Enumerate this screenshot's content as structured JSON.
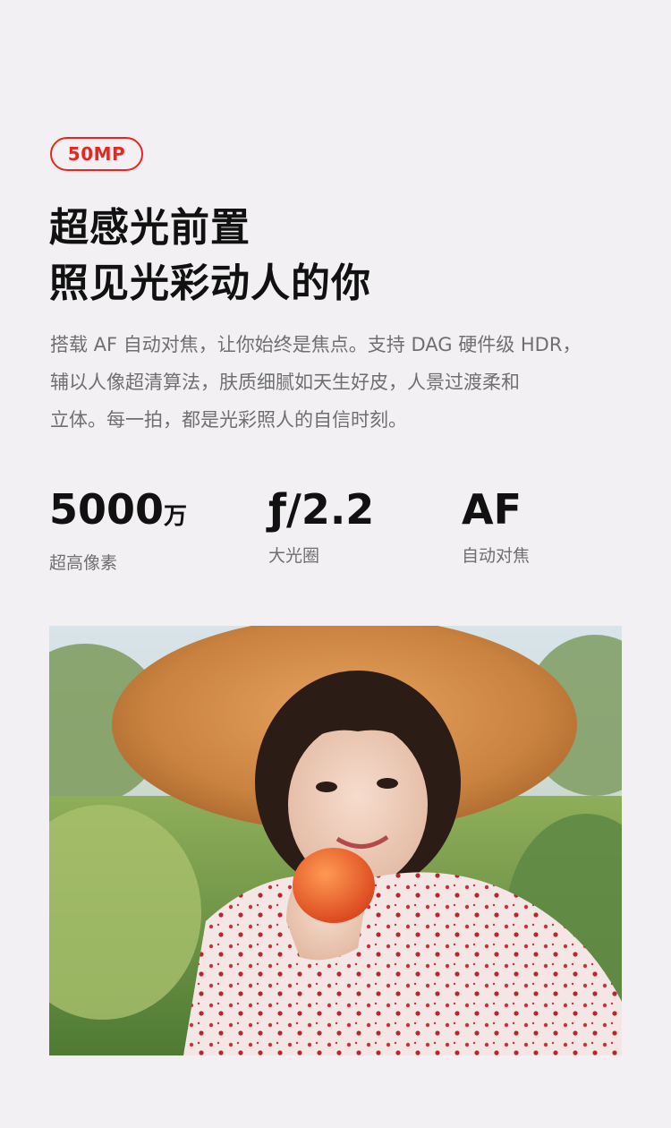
{
  "badge": "50MP",
  "headline": {
    "line1": "超感光前置",
    "line2": "照见光彩动人的你"
  },
  "description": {
    "line1": "搭载 AF 自动对焦，让你始终是焦点。支持 DAG 硬件级 HDR，",
    "line2": "辅以人像超清算法，肤质细腻如天生好皮，人景过渡柔和",
    "line3": "立体。每一拍，都是光彩照人的自信时刻。"
  },
  "specs": [
    {
      "value": "5000",
      "unit": "万",
      "label": "超高像素"
    },
    {
      "value": "ƒ/2.2",
      "unit": "",
      "label": "大光圈"
    },
    {
      "value": "AF",
      "unit": "",
      "label": "自动对焦"
    }
  ],
  "colors": {
    "accent": "#e8261f",
    "background": "#f2f0f2",
    "heading": "#111111",
    "body_text": "#6f6f72"
  }
}
